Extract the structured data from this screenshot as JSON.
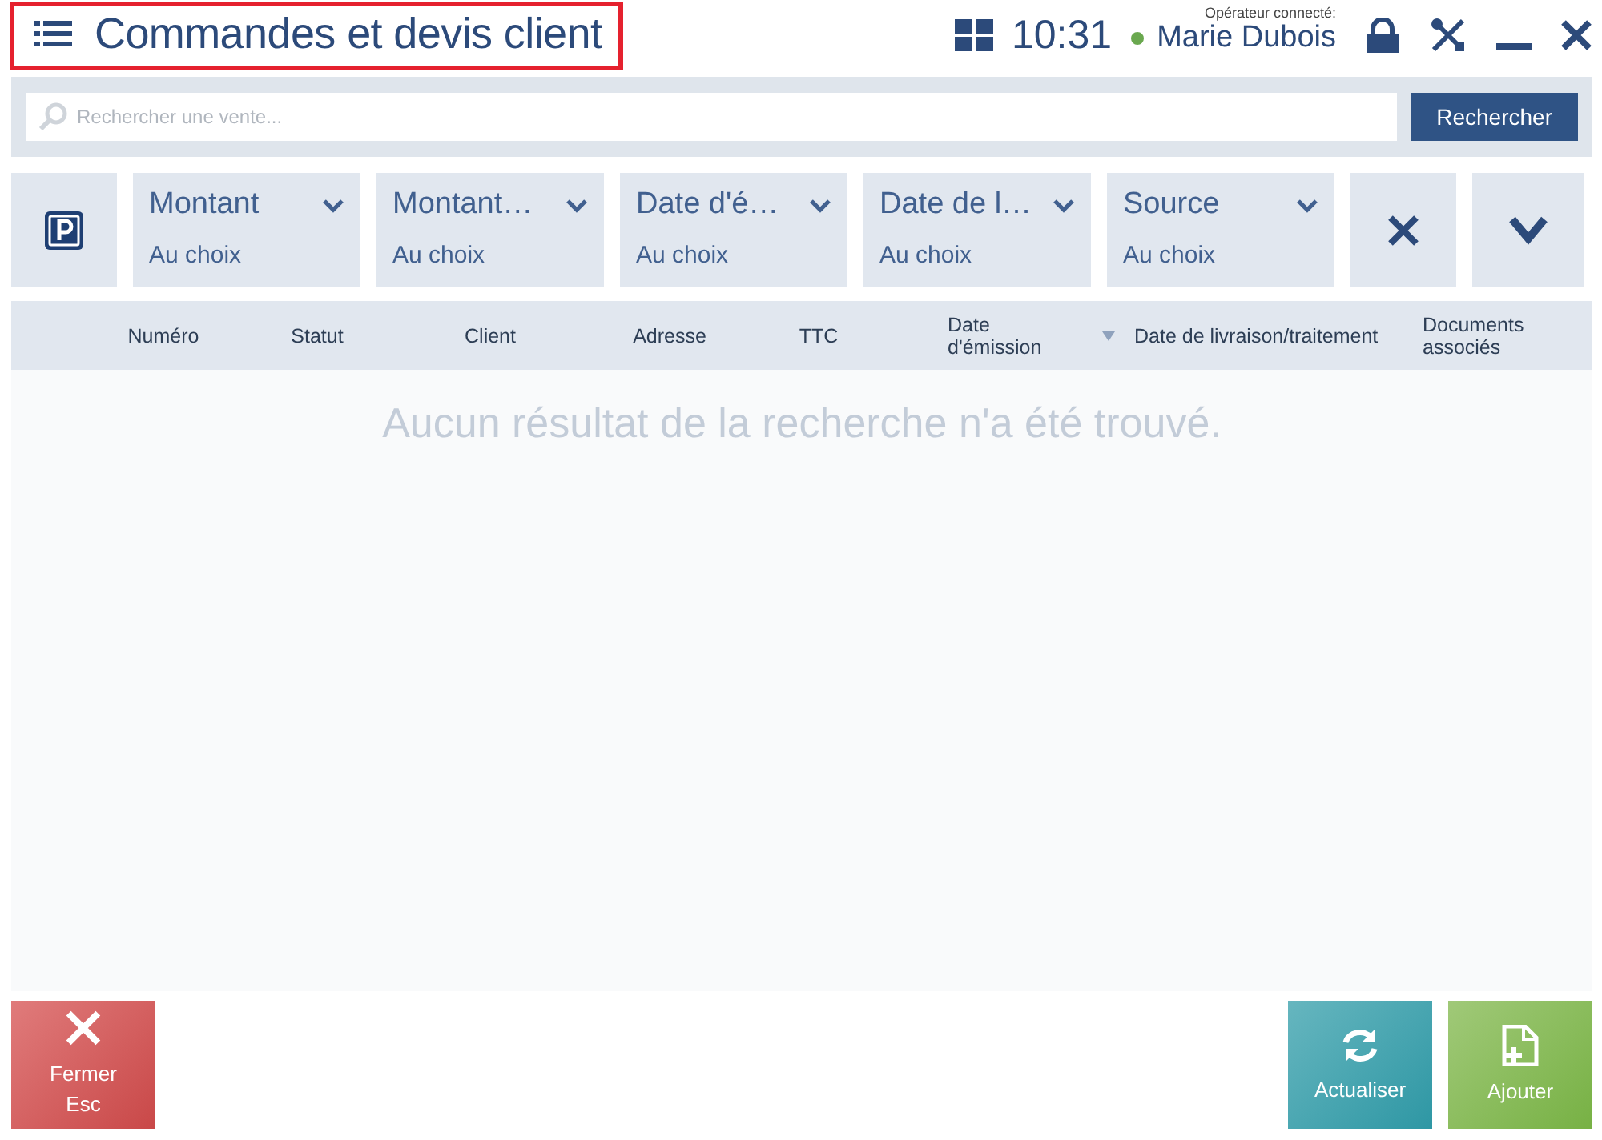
{
  "header": {
    "title": "Commandes et devis client",
    "time": "10:31",
    "operator_label": "Opérateur connecté:",
    "operator_name": "Marie Dubois",
    "online": true,
    "highlighted": true
  },
  "search": {
    "placeholder": "Rechercher une vente...",
    "button": "Rechercher"
  },
  "filters": [
    {
      "label": "Montant",
      "value": "Au choix"
    },
    {
      "label": "Montant…",
      "value": "Au choix"
    },
    {
      "label": "Date d'é…",
      "value": "Au choix"
    },
    {
      "label": "Date de l…",
      "value": "Au choix"
    },
    {
      "label": "Source",
      "value": "Au choix"
    }
  ],
  "table": {
    "columns": [
      {
        "label": "Numéro",
        "sorted": false
      },
      {
        "label": "Statut",
        "sorted": false
      },
      {
        "label": "Client",
        "sorted": false
      },
      {
        "label": "Adresse",
        "sorted": false
      },
      {
        "label": "TTC",
        "sorted": false
      },
      {
        "label": "Date d'émission",
        "sorted": true
      },
      {
        "label": "Date de livraison/traitement",
        "sorted": false
      },
      {
        "label": "Documents associés",
        "sorted": false
      }
    ],
    "empty_message": "Aucun résultat de la recherche n'a été trouvé."
  },
  "footer": {
    "close": {
      "label": "Fermer",
      "shortcut": "Esc"
    },
    "actions": [
      {
        "kind": "refresh",
        "label": "Actualiser"
      },
      {
        "kind": "add",
        "label": "Ajouter"
      }
    ]
  }
}
